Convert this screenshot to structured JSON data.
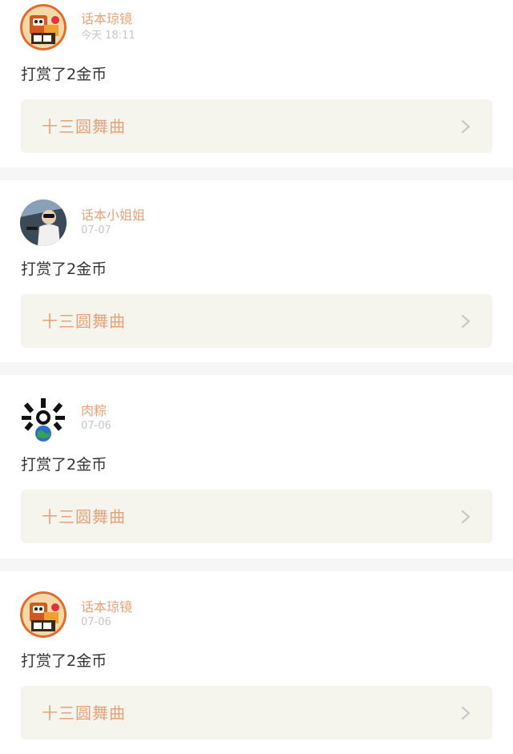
{
  "feed": {
    "items": [
      {
        "username": "话本琼镜",
        "time": "今天 18:11",
        "action": "打赏了2金币",
        "work_title": "十三圆舞曲",
        "avatar": "robot-mascot-avatar"
      },
      {
        "username": "话本小姐姐",
        "time": "07-07",
        "action": "打赏了2金币",
        "work_title": "十三圆舞曲",
        "avatar": "photo-person-avatar"
      },
      {
        "username": "肉粽",
        "time": "07-06",
        "action": "打赏了2金币",
        "work_title": "十三圆舞曲",
        "avatar": "earth-icon-avatar"
      },
      {
        "username": "话本琼镜",
        "time": "07-06",
        "action": "打赏了2金币",
        "work_title": "十三圆舞曲",
        "avatar": "robot-mascot-avatar"
      }
    ]
  },
  "colors": {
    "username": "#e4a27a",
    "time": "#c6c6c6",
    "action_text": "#333333",
    "work_box_bg": "#f5f4ed",
    "separator": "#f6f6f6",
    "chevron": "#c8c8c8"
  },
  "icons": {
    "chevron": "chevron-right-icon"
  }
}
